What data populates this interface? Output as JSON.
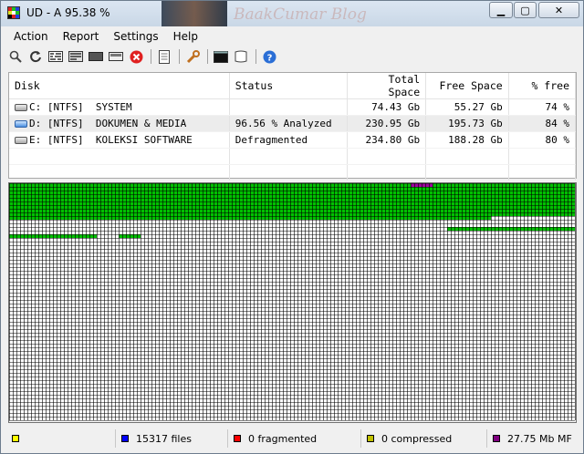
{
  "window": {
    "title": "UD - A  95.38 %"
  },
  "watermark": "BaakCumar Blog",
  "menu": [
    "Action",
    "Report",
    "Settings",
    "Help"
  ],
  "toolbar": [
    "search-icon",
    "refresh-icon",
    "defrag-icon",
    "optimize-icon",
    "repeat-icon",
    "stop-icon",
    "report-icon",
    "settings-icon",
    "console-icon",
    "boot-icon",
    "help-icon"
  ],
  "table": {
    "headers": {
      "disk": "Disk",
      "status": "Status",
      "total": "Total Space",
      "free": "Free Space",
      "pct": "% free"
    },
    "rows": [
      {
        "disk": "C: [NTFS]  SYSTEM",
        "status": "",
        "total": "74.43 Gb",
        "free": "55.27 Gb",
        "pct": "74 %"
      },
      {
        "disk": "D: [NTFS]  DOKUMEN & MEDIA",
        "status": "96.56 % Analyzed",
        "total": "230.95 Gb",
        "free": "195.73 Gb",
        "pct": "84 %"
      },
      {
        "disk": "E: [NTFS]  KOLEKSI SOFTWARE",
        "status": "Defragmented",
        "total": "234.80 Gb",
        "free": "188.28 Gb",
        "pct": "80 %"
      }
    ]
  },
  "status": {
    "dirs": "",
    "files": "15317 files",
    "fragmented": "0 fragmented",
    "compressed": "0 compressed",
    "mft": "27.75 Mb MF"
  },
  "colors": {
    "used": "#00c000",
    "mft": "#a000a0",
    "dirs": "#ffff00",
    "files": "#0000ff",
    "fragmented": "#ff0000",
    "compressed": "#c0c000",
    "mftlegend": "#800080"
  }
}
